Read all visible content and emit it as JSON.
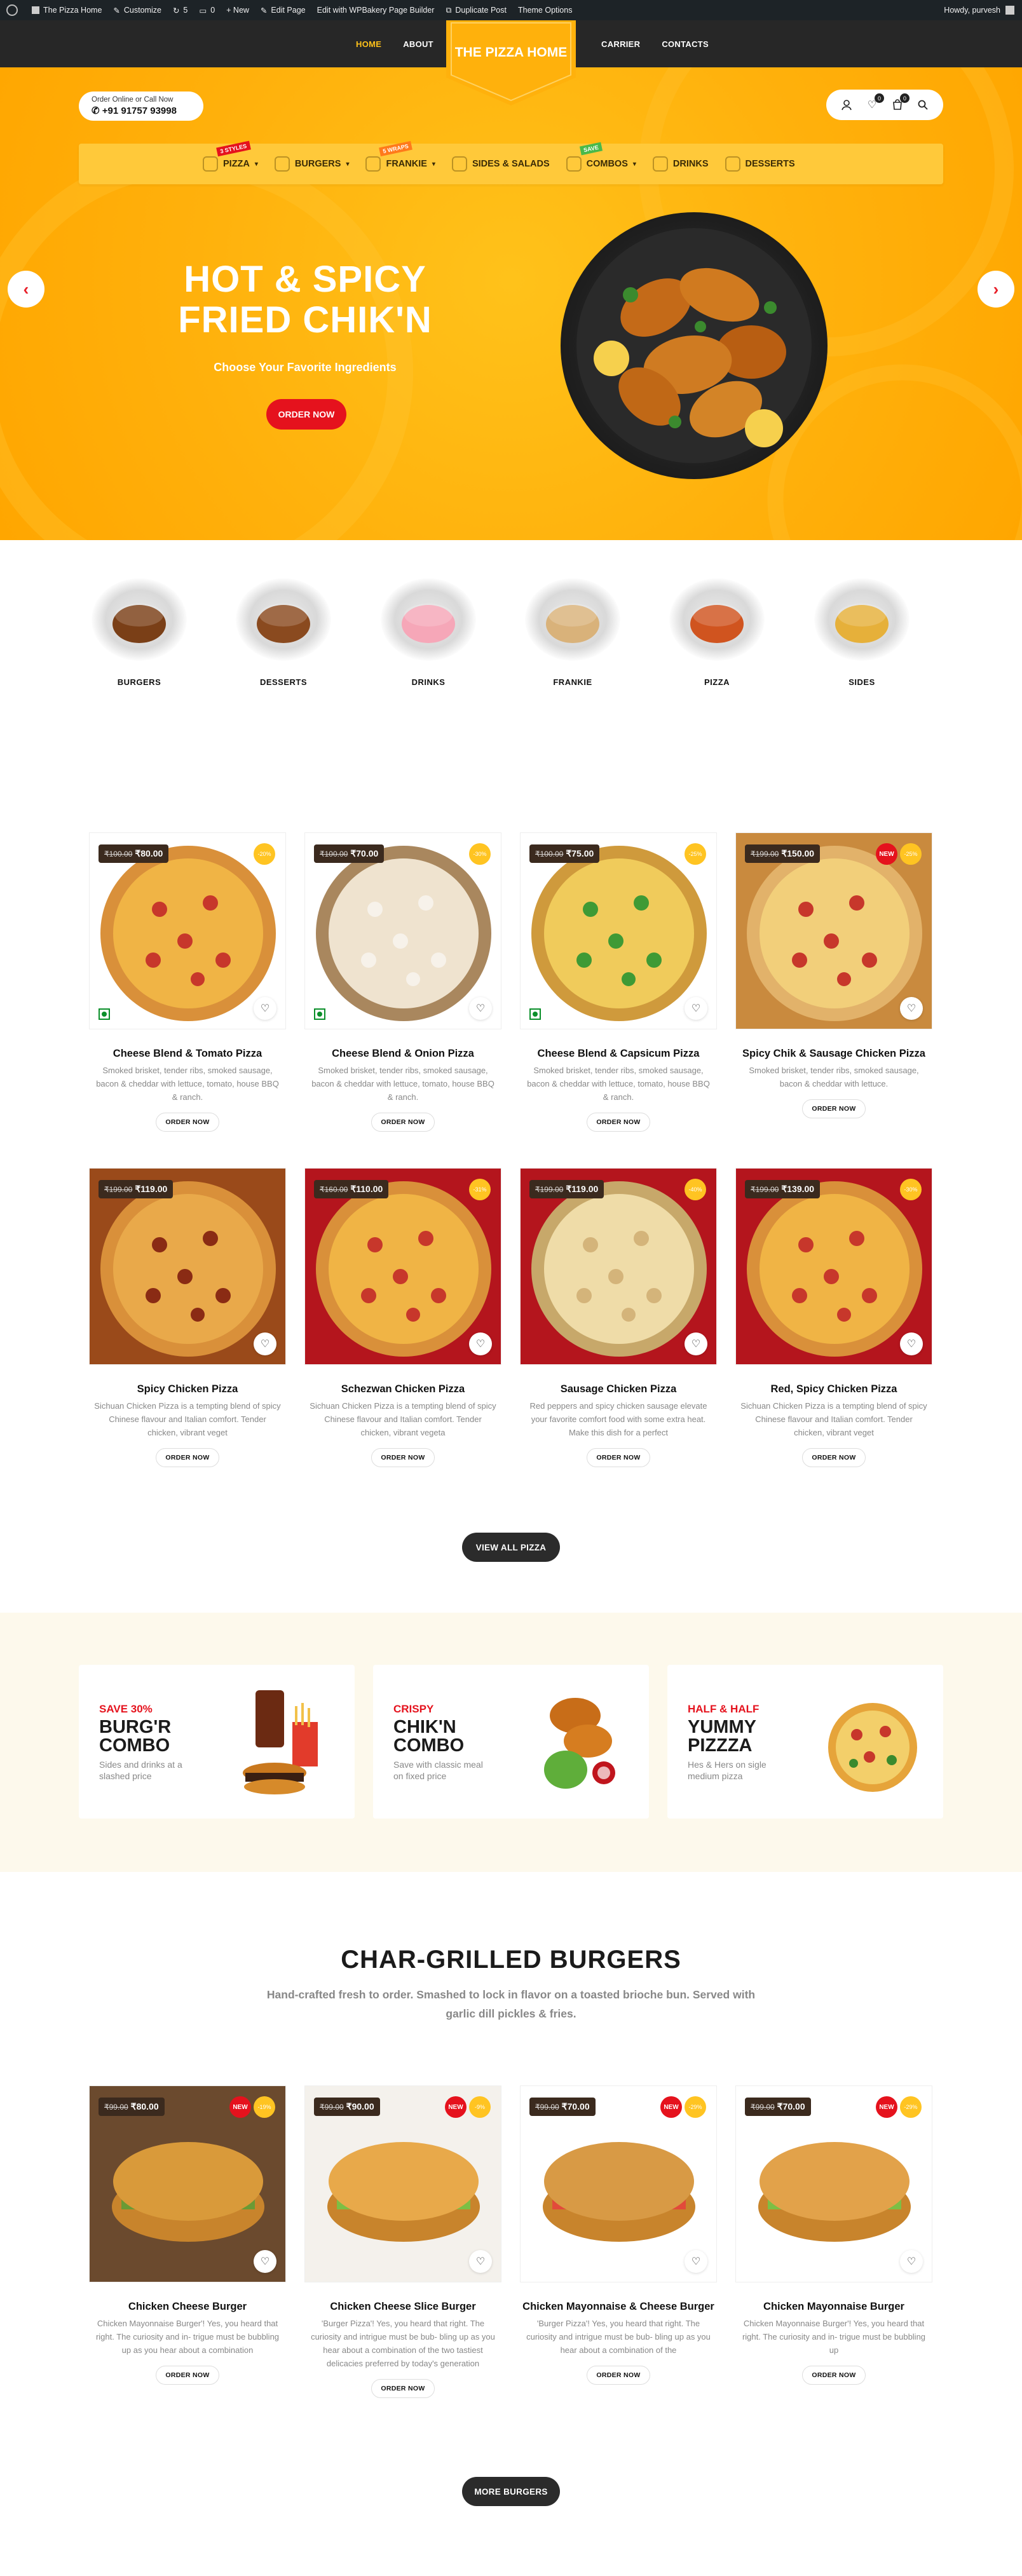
{
  "admin_bar": {
    "items": [
      "The Pizza Home",
      "Customize",
      "5",
      "0",
      "+ New",
      "Edit Page",
      "Edit with WPBakery Page Builder",
      "Duplicate Post",
      "Theme Options"
    ],
    "greeting": "Howdy, purvesh"
  },
  "nav": {
    "left": [
      "HOME",
      "ABOUT"
    ],
    "right": [
      "CARRIER",
      "CONTACTS"
    ],
    "logo": "THE PIZZA HOME"
  },
  "header": {
    "call_label": "Order Online or Call Now",
    "phone": "+91 91757 93998",
    "wishlist_count": "0",
    "cart_count": "0"
  },
  "menu": [
    {
      "label": "PIZZA",
      "tag": "3 STYLES",
      "tag_color": "#e5121d",
      "dropdown": true
    },
    {
      "label": "BURGERS",
      "tag": "",
      "dropdown": true
    },
    {
      "label": "FRANKIE",
      "tag": "5 WRAPS",
      "tag_color": "#ff7a1a",
      "dropdown": true
    },
    {
      "label": "SIDES & SALADS",
      "tag": "",
      "dropdown": false
    },
    {
      "label": "COMBOS",
      "tag": "SAVE",
      "tag_color": "#49b94a",
      "dropdown": true
    },
    {
      "label": "DRINKS",
      "tag": "",
      "dropdown": false
    },
    {
      "label": "DESSERTS",
      "tag": "",
      "dropdown": false
    }
  ],
  "hero": {
    "title_line1": "HOT & SPICY",
    "title_line2": "FRIED CHIK'N",
    "subtitle": "Choose Your Favorite Ingredients",
    "button": "ORDER NOW"
  },
  "categories": [
    "BURGERS",
    "DESSERTS",
    "DRINKS",
    "FRANKIE",
    "PIZZA",
    "SIDES"
  ],
  "pizzas": [
    {
      "name": "Cheese Blend & Tomato Pizza",
      "old": "₹100.00",
      "price": "₹80.00",
      "disc": "-20%",
      "new": false,
      "veg": true,
      "desc": "Smoked brisket, tender ribs, smoked sausage, bacon & cheddar with lettuce, tomato, house BBQ & ranch.",
      "btn": "ORDER NOW"
    },
    {
      "name": "Cheese Blend & Onion Pizza",
      "old": "₹100.00",
      "price": "₹70.00",
      "disc": "-30%",
      "new": false,
      "veg": true,
      "desc": "Smoked brisket, tender ribs, smoked sausage, bacon & cheddar with lettuce, tomato, house BBQ & ranch.",
      "btn": "ORDER NOW"
    },
    {
      "name": "Cheese Blend & Capsicum Pizza",
      "old": "₹100.00",
      "price": "₹75.00",
      "disc": "-25%",
      "new": false,
      "veg": true,
      "desc": "Smoked brisket, tender ribs, smoked sausage, bacon & cheddar with lettuce, tomato, house BBQ & ranch.",
      "btn": "ORDER NOW"
    },
    {
      "name": "Spicy Chik & Sausage Chicken Pizza",
      "old": "₹199.00",
      "price": "₹150.00",
      "disc": "-25%",
      "new": true,
      "veg": false,
      "desc": "Smoked brisket, tender ribs, smoked sausage, bacon & cheddar with lettuce.",
      "btn": "ORDER NOW"
    },
    {
      "name": "Spicy Chicken Pizza",
      "old": "₹199.00",
      "price": "₹119.00",
      "disc": "",
      "new": false,
      "veg": false,
      "desc": "Sichuan Chicken Pizza is a tempting blend of spicy Chinese flavour and Italian comfort. Tender chicken, vibrant veget",
      "btn": "ORDER NOW"
    },
    {
      "name": "Schezwan Chicken Pizza",
      "old": "₹160.00",
      "price": "₹110.00",
      "disc": "-31%",
      "new": false,
      "veg": false,
      "desc": "Sichuan Chicken Pizza is a tempting blend of spicy Chinese flavour and Italian comfort. Tender chicken, vibrant vegeta",
      "btn": "ORDER NOW"
    },
    {
      "name": "Sausage Chicken Pizza",
      "old": "₹199.00",
      "price": "₹119.00",
      "disc": "-40%",
      "new": false,
      "veg": false,
      "desc": "Red peppers and spicy chicken sausage elevate your favorite comfort food with some extra heat. Make this dish for a perfect",
      "btn": "ORDER NOW"
    },
    {
      "name": "Red, Spicy Chicken Pizza",
      "old": "₹199.00",
      "price": "₹139.00",
      "disc": "-30%",
      "new": false,
      "veg": false,
      "desc": "Sichuan Chicken Pizza is a tempting blend of spicy Chinese flavour and Italian comfort. Tender chicken, vibrant veget",
      "btn": "ORDER NOW"
    }
  ],
  "view_all_pizza": "VIEW ALL PIZZA",
  "combos": [
    {
      "kicker": "SAVE 30%",
      "title": "BURG'R COMBO",
      "desc": "Sides and drinks at a slashed price"
    },
    {
      "kicker": "CRISPY",
      "title": "CHIK'N COMBO",
      "desc": "Save with classic meal on fixed price"
    },
    {
      "kicker": "HALF & HALF",
      "title": "YUMMY PIZZZA",
      "desc": "Hes & Hers on sigle medium pizza"
    }
  ],
  "burgers_section": {
    "title": "CHAR-GRILLED BURGERS",
    "subtitle": "Hand-crafted fresh to order. Smashed to lock in flavor on a toasted brioche bun. Served with garlic dill pickles & fries."
  },
  "burgers": [
    {
      "name": "Chicken Cheese Burger",
      "old": "₹99.00",
      "price": "₹80.00",
      "disc": "-19%",
      "new": true,
      "desc": "Chicken Mayonnaise Burger'! Yes, you heard that right. The curiosity and in- trigue must be bubbling up as you hear about a combination",
      "btn": "ORDER NOW"
    },
    {
      "name": "Chicken Cheese Slice Burger",
      "old": "₹99.00",
      "price": "₹90.00",
      "disc": "-9%",
      "new": true,
      "desc": "'Burger Pizza'! Yes, you heard that right. The curiosity and intrigue must be bub- bling up as you hear about a combination of the two tastiest delicacies preferred by today's generation",
      "btn": "ORDER NOW"
    },
    {
      "name": "Chicken Mayonnaise & Cheese Burger",
      "old": "₹99.00",
      "price": "₹70.00",
      "disc": "-29%",
      "new": true,
      "desc": "'Burger Pizza'! Yes, you heard that right. The curiosity and intrigue must be bub- bling up as you hear about a combination of the",
      "btn": "ORDER NOW"
    },
    {
      "name": "Chicken Mayonnaise Burger",
      "old": "₹99.00",
      "price": "₹70.00",
      "disc": "-29%",
      "new": true,
      "desc": "Chicken Mayonnaise Burger'! Yes, you heard that right. The curiosity and in- trigue must be bubbling up",
      "btn": "ORDER NOW"
    }
  ],
  "more_burgers": "MORE BURGERS",
  "colors": {
    "brand_yellow": "#ffb10c",
    "accent_red": "#e5121d",
    "dark": "#272727"
  }
}
